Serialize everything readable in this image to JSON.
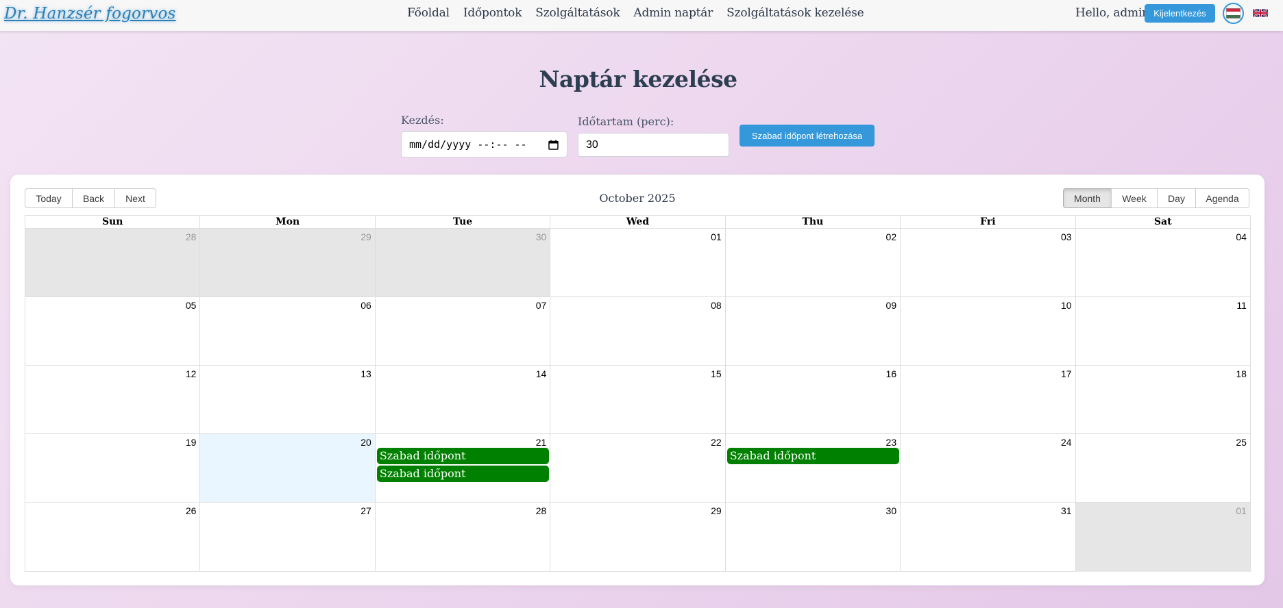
{
  "navbar": {
    "brand": "Dr. Hanzsér fogorvos",
    "links": [
      "Főoldal",
      "Időpontok",
      "Szolgáltatások",
      "Admin naptár",
      "Szolgáltatások kezelése"
    ],
    "greeting": "Hello, admin",
    "logout_label": "Kijelentkezés",
    "flags": [
      "hungarian-flag-icon",
      "uk-flag-icon"
    ]
  },
  "page": {
    "title": "Naptár kezelése"
  },
  "form": {
    "start_label": "Kezdés:",
    "start_value": "mm/dd/yyyy --:-- --",
    "duration_label": "Időtartam (perc):",
    "duration_value": "30",
    "create_label": "Szabad időpont létrehozása"
  },
  "calendar": {
    "nav_buttons": [
      "Today",
      "Back",
      "Next"
    ],
    "month_label": "October 2025",
    "view_buttons": [
      "Month",
      "Week",
      "Day",
      "Agenda"
    ],
    "active_view": "Month",
    "weekdays": [
      "Sun",
      "Mon",
      "Tue",
      "Wed",
      "Thu",
      "Fri",
      "Sat"
    ],
    "weeks": [
      [
        {
          "d": "28",
          "off": true
        },
        {
          "d": "29",
          "off": true
        },
        {
          "d": "30",
          "off": true
        },
        {
          "d": "01"
        },
        {
          "d": "02"
        },
        {
          "d": "03"
        },
        {
          "d": "04"
        }
      ],
      [
        {
          "d": "05"
        },
        {
          "d": "06"
        },
        {
          "d": "07"
        },
        {
          "d": "08"
        },
        {
          "d": "09"
        },
        {
          "d": "10"
        },
        {
          "d": "11"
        }
      ],
      [
        {
          "d": "12"
        },
        {
          "d": "13"
        },
        {
          "d": "14"
        },
        {
          "d": "15"
        },
        {
          "d": "16"
        },
        {
          "d": "17"
        },
        {
          "d": "18"
        }
      ],
      [
        {
          "d": "19"
        },
        {
          "d": "20",
          "today": true
        },
        {
          "d": "21",
          "events": [
            "Szabad időpont",
            "Szabad időpont"
          ]
        },
        {
          "d": "22"
        },
        {
          "d": "23",
          "events": [
            "Szabad időpont"
          ]
        },
        {
          "d": "24"
        },
        {
          "d": "25"
        }
      ],
      [
        {
          "d": "26"
        },
        {
          "d": "27"
        },
        {
          "d": "28"
        },
        {
          "d": "29"
        },
        {
          "d": "30"
        },
        {
          "d": "31"
        },
        {
          "d": "01",
          "off": true
        }
      ]
    ]
  },
  "colors": {
    "accent": "#3498db",
    "event": "#008000",
    "today_bg": "#eaf6ff",
    "off_range_bg": "#e6e6e6"
  }
}
